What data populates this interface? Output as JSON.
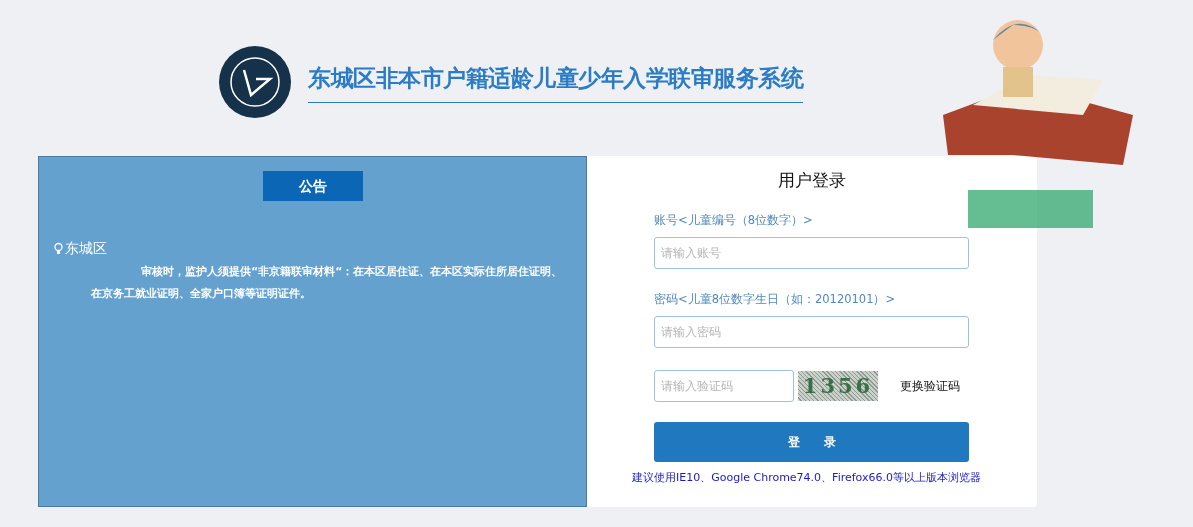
{
  "header": {
    "title": "东城区非本市户籍适龄儿童少年入学联审服务系统"
  },
  "notice": {
    "heading": "公告",
    "district": "东城区",
    "text": "审核时，监护人须提供“非京籍联审材料“：在本区居住证、在本区实际住所居住证明、在京务工就业证明、全家户口簿等证明证件。"
  },
  "login": {
    "title": "用户登录",
    "fields": [
      {
        "label": "账号<儿童编号（8位数字）>",
        "placeholder": "请输入账号"
      },
      {
        "label": "密码<儿童8位数字生日（如：20120101）>",
        "placeholder": "请输入密码"
      }
    ],
    "captcha": {
      "placeholder": "请输入验证码",
      "code": "1356",
      "refresh": "更换验证码"
    },
    "submit": "登　　录",
    "browser_hint": "建议使用IE10、Google Chrome74.0、Firefox66.0等以上版本浏览器"
  }
}
